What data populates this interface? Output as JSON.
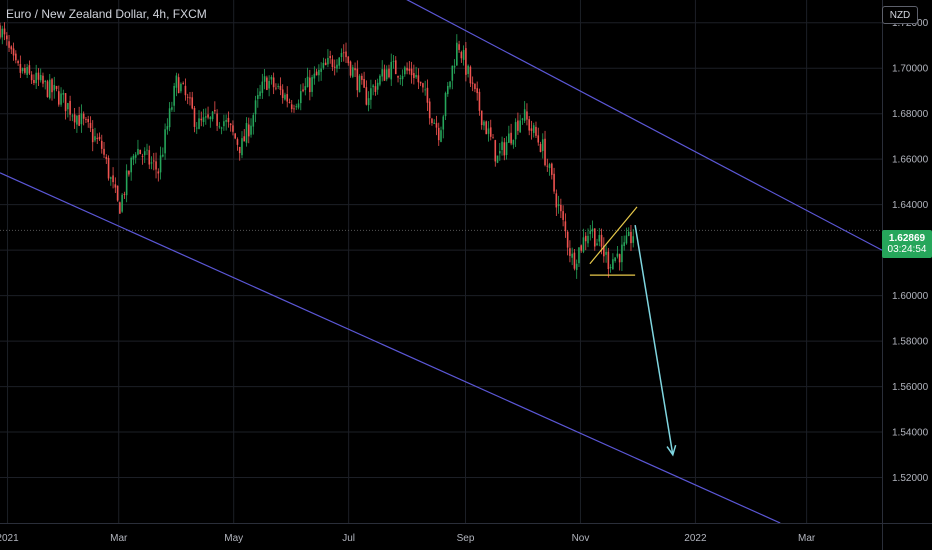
{
  "header": {
    "title": "Euro / New Zealand Dollar, 4h, FXCM",
    "currency": "NZD"
  },
  "price_tag": {
    "price": "1.62869",
    "countdown": "03:24:54"
  },
  "colors": {
    "background": "#000000",
    "grid": "#1c1f26",
    "axis_text": "#b2b5be",
    "up": "#26a65b",
    "down": "#ef5350",
    "channel": "#5b57d6",
    "wedge": "#e7c94a",
    "arrow": "#7fd6e0",
    "price_tag": "#26a65b"
  },
  "chart_data": {
    "type": "candlestick",
    "title": "Euro / New Zealand Dollar, 4h, FXCM",
    "ylim": [
      1.5,
      1.73
    ],
    "y_ticks": [
      "1.72000",
      "1.70000",
      "1.68000",
      "1.66000",
      "1.64000",
      "1.62000",
      "1.60000",
      "1.58000",
      "1.56000",
      "1.54000",
      "1.52000"
    ],
    "x_ticks": [
      "2021",
      "Mar",
      "May",
      "Jul",
      "Sep",
      "Nov",
      "2022",
      "Mar"
    ],
    "x_tick_dates": [
      "2021-01-01",
      "2021-03-01",
      "2021-05-01",
      "2021-07-01",
      "2021-09-01",
      "2021-11-01",
      "2022-01-01",
      "2022-03-01"
    ],
    "xlim": [
      "2020-12-28",
      "2022-04-10"
    ],
    "grid": true,
    "last_price": 1.62869,
    "price_path": [
      {
        "date": "2020-12-28",
        "price": 1.718
      },
      {
        "date": "2021-01-05",
        "price": 1.7
      },
      {
        "date": "2021-01-15",
        "price": 1.695
      },
      {
        "date": "2021-01-28",
        "price": 1.688
      },
      {
        "date": "2021-02-08",
        "price": 1.678
      },
      {
        "date": "2021-02-20",
        "price": 1.665
      },
      {
        "date": "2021-03-01",
        "price": 1.638
      },
      {
        "date": "2021-03-10",
        "price": 1.665
      },
      {
        "date": "2021-03-22",
        "price": 1.655
      },
      {
        "date": "2021-04-01",
        "price": 1.695
      },
      {
        "date": "2021-04-12",
        "price": 1.675
      },
      {
        "date": "2021-04-25",
        "price": 1.678
      },
      {
        "date": "2021-05-05",
        "price": 1.665
      },
      {
        "date": "2021-05-18",
        "price": 1.695
      },
      {
        "date": "2021-06-01",
        "price": 1.685
      },
      {
        "date": "2021-06-15",
        "price": 1.697
      },
      {
        "date": "2021-06-28",
        "price": 1.708
      },
      {
        "date": "2021-07-10",
        "price": 1.687
      },
      {
        "date": "2021-07-22",
        "price": 1.7
      },
      {
        "date": "2021-08-05",
        "price": 1.698
      },
      {
        "date": "2021-08-18",
        "price": 1.672
      },
      {
        "date": "2021-08-28",
        "price": 1.712
      },
      {
        "date": "2021-09-05",
        "price": 1.69
      },
      {
        "date": "2021-09-18",
        "price": 1.66
      },
      {
        "date": "2021-10-01",
        "price": 1.68
      },
      {
        "date": "2021-10-12",
        "price": 1.665
      },
      {
        "date": "2021-10-20",
        "price": 1.64
      },
      {
        "date": "2021-10-28",
        "price": 1.615
      },
      {
        "date": "2021-11-06",
        "price": 1.63
      },
      {
        "date": "2021-11-16",
        "price": 1.615
      },
      {
        "date": "2021-11-24",
        "price": 1.62
      },
      {
        "date": "2021-11-30",
        "price": 1.62869
      }
    ],
    "drawings": {
      "channel_upper": [
        {
          "date": "2021-05-20",
          "price": 1.762
        },
        {
          "date": "2022-04-10",
          "price": 1.62
        }
      ],
      "channel_lower": [
        {
          "date": "2020-12-28",
          "price": 1.654
        },
        {
          "date": "2022-02-15",
          "price": 1.5
        }
      ],
      "wedge_upper": [
        {
          "date": "2021-11-06",
          "price": 1.614
        },
        {
          "date": "2021-12-01",
          "price": 1.639
        }
      ],
      "wedge_lower": [
        {
          "date": "2021-11-06",
          "price": 1.609
        },
        {
          "date": "2021-11-30",
          "price": 1.609
        }
      ],
      "projection_arrow": [
        {
          "date": "2021-11-30",
          "price": 1.631
        },
        {
          "date": "2021-12-20",
          "price": 1.53
        }
      ]
    }
  }
}
